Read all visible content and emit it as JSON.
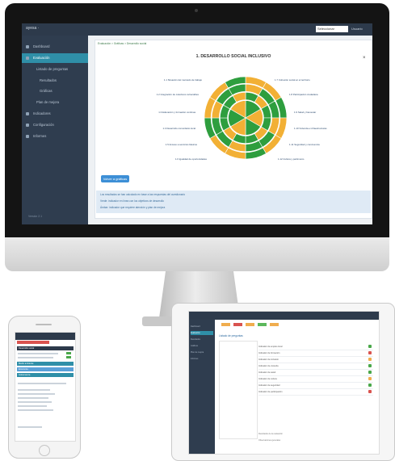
{
  "desktop": {
    "app_logo": "ayesa ·",
    "top_select": "Seleccionar",
    "top_user": "Usuario",
    "sidebar_items": [
      {
        "label": "Dashboard"
      },
      {
        "label": "Evaluación"
      },
      {
        "label": "Listado de preguntas"
      },
      {
        "label": "Resultados"
      },
      {
        "label": "Gráficas"
      },
      {
        "label": "Plan de mejora"
      },
      {
        "label": "Indicadores"
      },
      {
        "label": "Configuración"
      },
      {
        "label": "Informes"
      }
    ],
    "sidebar_footer": "Versión 2.1",
    "breadcrumb": "Evaluación > Gráficas > Desarrollo social",
    "chart_title": "1. DESARROLLO SOCIAL INCLUSIVO",
    "close_label": "×",
    "chart_button": "Volver a gráficas",
    "info_lines": [
      "Los resultados se han calculado en base a las respuestas del cuestionario",
      "Verde: indicador en línea con los objetivos de desarrollo",
      "Ámbar: indicador que requiere atención y plan de mejora"
    ],
    "radar_labels_left": [
      "1.1 Situación del mercado de trabajo",
      "1.2 Integración de colectivos vulnerables",
      "1.3 Educación y formación continua",
      "1.4 Desarrollo comunitario local",
      "1.5 Acceso a servicios básicos",
      "1.6 Igualdad de oportunidades"
    ],
    "radar_labels_right": [
      "1.7 Cohesión social en el territorio",
      "1.8 Participación ciudadana",
      "1.9 Salud y bienestar",
      "1.10 Vivienda e infraestructuras",
      "1.11 Seguridad y convivencia",
      "1.12 Cultura y patrimonio"
    ]
  },
  "phone": {
    "bars": [
      "Desarrollo social",
      "Medio ambiente",
      "Economía",
      "Gobernanza"
    ]
  },
  "tablet": {
    "side_items": [
      "Dashboard",
      "Evaluación",
      "Resultados",
      "Gráficas",
      "Plan de mejora",
      "Informes"
    ],
    "heading": "Listado de preguntas",
    "rows": [
      "Indicador de empleo local",
      "Indicador de formación",
      "Indicador de inclusión",
      "Indicador de vivienda",
      "Indicador de salud",
      "Indicador de cultura",
      "Indicador de seguridad",
      "Indicador de participación"
    ],
    "footer_lines": [
      "Resultados de la evaluación",
      "Observaciones generales"
    ]
  },
  "colors": {
    "green": "#2e9e3e",
    "amber": "#f2b035",
    "sidebar": "#2f3d4f",
    "accent": "#2f8fa8"
  }
}
